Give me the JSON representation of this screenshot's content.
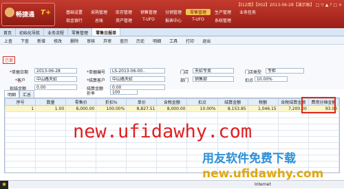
{
  "app": {
    "version": "T+",
    "status_bar": "【t12用】【002】2013-06-28【演示账】 □ ▽ ▲ ? □ ×"
  },
  "menu": {
    "row1": [
      "基础设置",
      "采购管理",
      "库存管理",
      "销售管理",
      "分销管理",
      "零售管理",
      "生产管理",
      "业务任务"
    ],
    "row2": [
      "现金银行",
      "总账",
      "资产管理",
      "T-UFO",
      "报表中心",
      "T-UFO",
      "系统管理"
    ],
    "active": "零售管理"
  },
  "tabs": [
    "首页",
    "初始化导航",
    "业务流程",
    "零售管理",
    "零售日报单"
  ],
  "toolbar": [
    "上查",
    "下查",
    "新增",
    "修改",
    "删除",
    "审核",
    "弃审",
    "查历",
    "历史",
    "明细",
    "工具",
    "打印",
    "退出"
  ],
  "form": {
    "state": "已审",
    "date_label": "单据日期",
    "date": "2013-06-28",
    "no_label": "单据编号",
    "no": "LS-2013-06-00..",
    "store_label": "门店",
    "store": "天虹专卖",
    "storetype_label": "门店类型",
    "storetype": "专柜",
    "customer_label": "客户",
    "customer": "中山路天虹",
    "settle_label": "结算客户",
    "settle": "中山路天虹",
    "dept_label": "部门",
    "dept": "销售部",
    "rate_label": "扣点",
    "rate": "10.00%",
    "cash_label": "现结金额",
    "cash": "0.00",
    "cashamt_label": "结算金额",
    "cashamt": "0.00",
    "disc_label": "折率",
    "disc": "100"
  },
  "grid_tabs": [
    "明细",
    "汇总"
  ],
  "grid": {
    "headers": [
      "序号",
      "数量",
      "零售价",
      "折扣%",
      "单价",
      "含税金额",
      "扣点",
      "结算金额",
      "税额",
      "含税结算金额",
      "费用分摊金额"
    ],
    "rows": [
      [
        "1",
        "1.00",
        "8,000.00",
        "100.00%",
        "8,827.51",
        "8,000.00",
        "10.00%",
        "8,153.85",
        "1,046.15",
        "7,200.00",
        "93.00"
      ]
    ]
  },
  "watermark": {
    "url": "new.ufidawhy.com",
    "cn": "用友软件免费下载",
    "url2": "new.ufidawhy.com"
  },
  "statusbar": {
    "net": "Internet"
  }
}
